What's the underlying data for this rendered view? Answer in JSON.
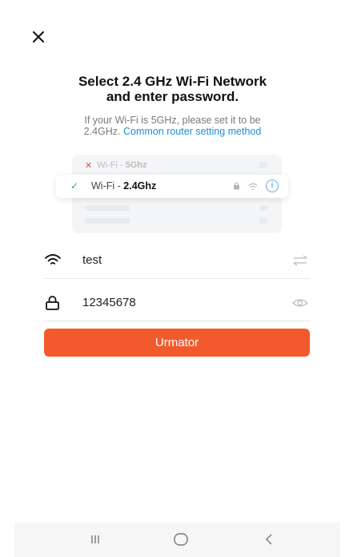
{
  "header": {
    "close_icon": "close-icon"
  },
  "title": {
    "line1": "Select 2.4 GHz Wi-Fi Network",
    "line2": "and enter password."
  },
  "subtitle": {
    "text_line1": "If your Wi-Fi is 5GHz, please set it to be",
    "text_line2_prefix": "2.4GHz.",
    "link": "Common router setting method"
  },
  "illustration": {
    "row1_prefix": "Wi-Fi -",
    "row1_band": "5Ghz",
    "row2_prefix": "Wi-Fi -",
    "row2_band": "2.4Ghz",
    "row2_info": "i"
  },
  "wifi": {
    "ssid": "test",
    "password": "12345678"
  },
  "next_button": {
    "label": "Urmator",
    "color": "#f25a2d"
  },
  "colors": {
    "link": "#1a8fd6",
    "accent": "#f25a2d"
  },
  "navbar": {
    "recents_icon": "recent-apps-icon",
    "home_icon": "home-icon",
    "back_icon": "back-icon"
  }
}
